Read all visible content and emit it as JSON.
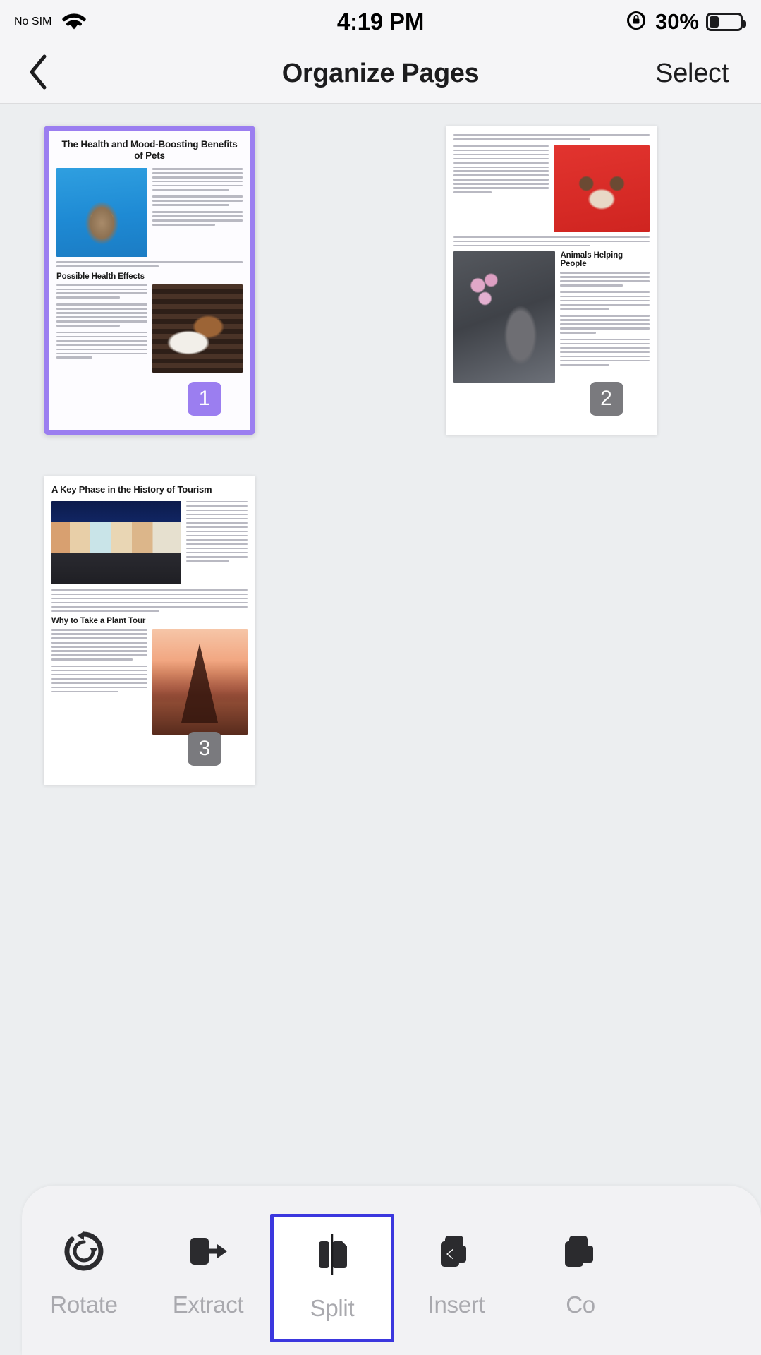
{
  "status_bar": {
    "carrier": "No SIM",
    "wifi_icon": "wifi-icon",
    "time": "4:19 PM",
    "orientation_lock_icon": "rotation-lock-icon",
    "battery_percent": "30%",
    "battery_level": 30,
    "battery_icon": "battery-icon"
  },
  "nav_bar": {
    "back_icon": "chevron-left-icon",
    "title": "Organize Pages",
    "select_label": "Select"
  },
  "pages": [
    {
      "number": "1",
      "selected": true,
      "badge_color": "#9b7ef0",
      "title": "The Health and Mood-Boosting Benefits of Pets",
      "section_heading": "Possible Health Effects",
      "images": [
        "cat-on-blue-background-photo",
        "dog-and-cat-resting-photo"
      ]
    },
    {
      "number": "2",
      "selected": false,
      "badge_color": "#7a7a7e",
      "title": "",
      "section_heading": "Animals Helping People",
      "images": [
        "dogs-in-holiday-costumes-red-background-photo",
        "grey-cat-with-tulips-photo"
      ]
    },
    {
      "number": "3",
      "selected": false,
      "badge_color": "#7a7a7e",
      "title": "A Key Phase in the History of Tourism",
      "section_heading": "Why to Take a Plant Tour",
      "images": [
        "pink-classic-car-in-havana-photo",
        "eiffel-tower-at-sunset-photo"
      ]
    }
  ],
  "toolbar": {
    "items": [
      {
        "label": "Rotate",
        "icon": "rotate-icon",
        "selected": false
      },
      {
        "label": "Extract",
        "icon": "extract-icon",
        "selected": false
      },
      {
        "label": "Split",
        "icon": "split-icon",
        "selected": true
      },
      {
        "label": "Insert",
        "icon": "insert-icon",
        "selected": false
      },
      {
        "label": "Co",
        "icon": "copy-icon",
        "selected": false
      }
    ],
    "highlight_color": "#3b37de"
  }
}
